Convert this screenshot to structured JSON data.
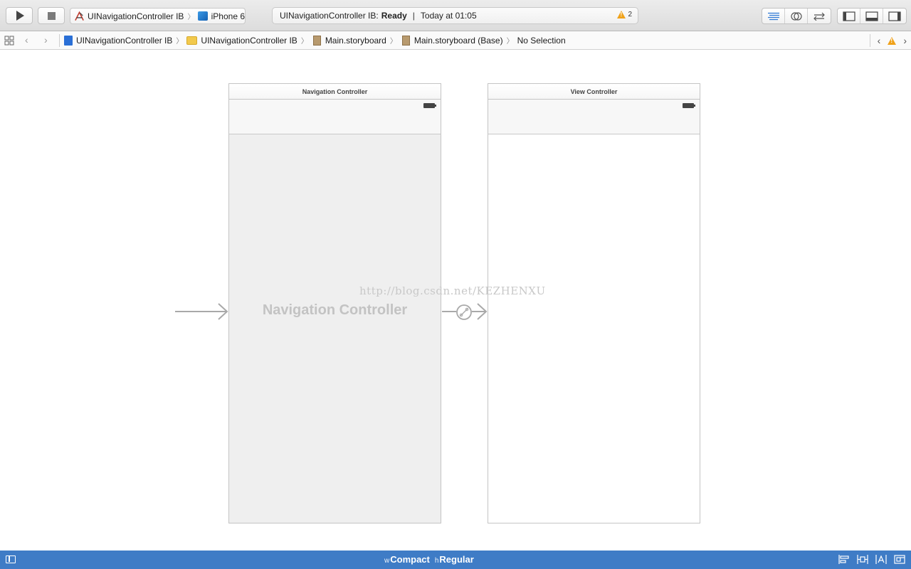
{
  "toolbar": {
    "scheme_name": "UINavigationController IB",
    "scheme_separator": "〉",
    "device_name": "iPhone 6",
    "activity_project": "UINavigationController IB:",
    "activity_status": "Ready",
    "activity_separator": "|",
    "activity_time": "Today at 01:05",
    "warning_count": "2"
  },
  "jumpbar": {
    "back": "‹",
    "forward": "›",
    "chevron": "〉",
    "crumbs": [
      {
        "label": "UINavigationController IB",
        "icon": "project-icon"
      },
      {
        "label": "UINavigationController IB",
        "icon": "folder-icon"
      },
      {
        "label": "Main.storyboard",
        "icon": "storyboard-icon"
      },
      {
        "label": "Main.storyboard (Base)",
        "icon": "storyboard-icon"
      },
      {
        "label": "No Selection",
        "icon": ""
      }
    ],
    "nav_prev": "‹",
    "nav_next": "›"
  },
  "canvas": {
    "nav_scene_title": "Navigation Controller",
    "nav_body_label": "Navigation Controller",
    "vc_scene_title": "View Controller",
    "watermark_url": "http://blog.csdn.net/KEZHENXU"
  },
  "bottombar": {
    "width_prefix": "w",
    "width_class": "Compact",
    "height_prefix": "h",
    "height_class": "Regular"
  },
  "colors": {
    "accent_blue": "#3f7cc6",
    "warning_yellow": "#f0a21a",
    "nav_body_bg": "#efefef"
  }
}
